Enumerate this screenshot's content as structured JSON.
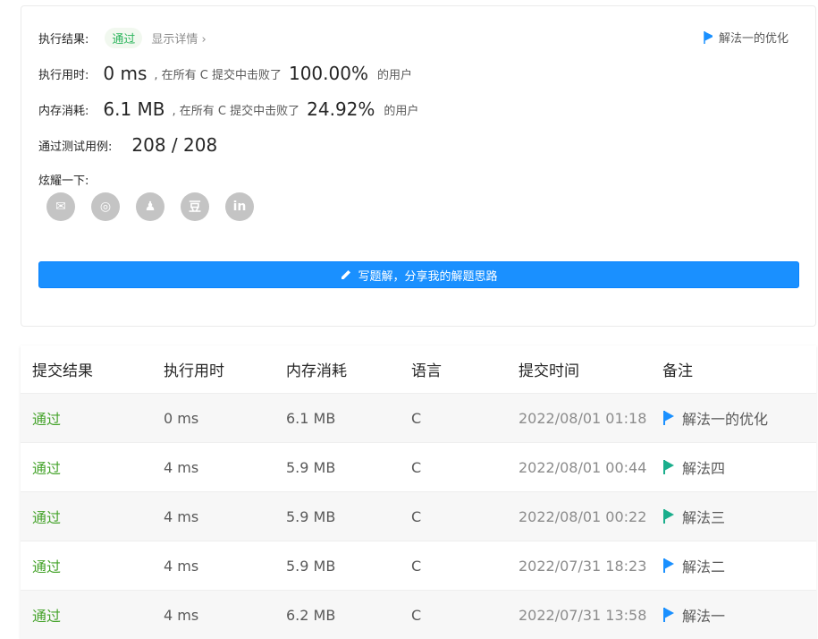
{
  "summary": {
    "result_label": "执行结果:",
    "result_value": "通过",
    "detail_link": "显示详情 ›",
    "solution_note": "解法一的优化",
    "runtime_label": "执行用时:",
    "runtime_value": "0 ms",
    "runtime_mid": ", 在所有 C 提交中击败了",
    "runtime_pct": "100.00%",
    "runtime_suffix": "的用户",
    "memory_label": "内存消耗:",
    "memory_value": "6.1 MB",
    "memory_mid": ", 在所有 C 提交中击败了",
    "memory_pct": "24.92%",
    "memory_suffix": "的用户",
    "testcase_label": "通过测试用例:",
    "testcase_value": "208 / 208",
    "share_label": "炫耀一下:",
    "share_icons": [
      "wechat-icon",
      "weibo-icon",
      "qq-icon",
      "douban-icon",
      "linkedin-icon"
    ],
    "share_glyphs": [
      "✉",
      "◎",
      "♟",
      "豆",
      "in"
    ],
    "write_button": "写题解，分享我的解题思路"
  },
  "table": {
    "headers": [
      "提交结果",
      "执行用时",
      "内存消耗",
      "语言",
      "提交时间",
      "备注"
    ],
    "rows": [
      {
        "result": "通过",
        "runtime": "0 ms",
        "memory": "6.1 MB",
        "lang": "C",
        "time": "2022/08/01 01:18",
        "note": "解法一的优化",
        "flag_color": "#1a90ff"
      },
      {
        "result": "通过",
        "runtime": "4 ms",
        "memory": "5.9 MB",
        "lang": "C",
        "time": "2022/08/01 00:44",
        "note": "解法四",
        "flag_color": "#1aae8c"
      },
      {
        "result": "通过",
        "runtime": "4 ms",
        "memory": "5.9 MB",
        "lang": "C",
        "time": "2022/08/01 00:22",
        "note": "解法三",
        "flag_color": "#1aae8c"
      },
      {
        "result": "通过",
        "runtime": "4 ms",
        "memory": "5.9 MB",
        "lang": "C",
        "time": "2022/07/31 18:23",
        "note": "解法二",
        "flag_color": "#1a90ff"
      },
      {
        "result": "通过",
        "runtime": "4 ms",
        "memory": "6.2 MB",
        "lang": "C",
        "time": "2022/07/31 13:58",
        "note": "解法一",
        "flag_color": "#1a90ff"
      }
    ]
  },
  "colors": {
    "accent": "#1a90ff",
    "pass": "#45a32b"
  }
}
